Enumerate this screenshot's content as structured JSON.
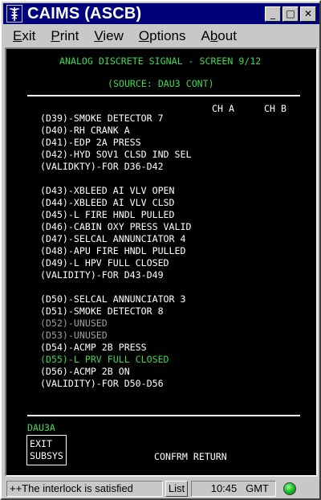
{
  "window": {
    "title": "CAIMS (ASCB)",
    "icon": "caduceus-icon",
    "controls": {
      "minimize": "_",
      "maximize": "□",
      "close": "✕"
    }
  },
  "menu": [
    {
      "mnemonic": "E",
      "rest": "xit"
    },
    {
      "mnemonic": "P",
      "rest": "rint"
    },
    {
      "mnemonic": "V",
      "rest": "iew"
    },
    {
      "mnemonic": "O",
      "rest": "ptions"
    },
    {
      "pre": "A",
      "mnemonic": "b",
      "rest": "out"
    }
  ],
  "screen": {
    "title": "ANALOG DISCRETE SIGNAL - SCREEN 9/12",
    "source": "(SOURCE: DAU3 CONT)",
    "columns": {
      "ch_a": "CH A",
      "ch_b": "CH B"
    },
    "groups": [
      [
        {
          "text": "(D39)-SMOKE DETECTOR 7",
          "color": "white"
        },
        {
          "text": "(D40)-RH CRANK A",
          "color": "white"
        },
        {
          "text": "(D41)-EDP 2A PRESS",
          "color": "white"
        },
        {
          "text": "(D42)-HYD SOV1 CLSD IND SEL",
          "color": "white"
        },
        {
          "text": "(VALIDKTY)-FOR D36-D42",
          "color": "white"
        }
      ],
      [
        {
          "text": "(D43)-XBLEED AI VLV OPEN",
          "color": "white"
        },
        {
          "text": "(D44)-XBLEED AI VLV CLSD",
          "color": "white"
        },
        {
          "text": "(D45)-L FIRE HNDL PULLED",
          "color": "white"
        },
        {
          "text": "(D46)-CABIN OXY PRESS VALID",
          "color": "white"
        },
        {
          "text": "(D47)-SELCAL ANNUNCIATOR 4",
          "color": "white"
        },
        {
          "text": "(D48)-APU FIRE HNDL PULLED",
          "color": "white"
        },
        {
          "text": "(D49)-L HPV FULL CLOSED",
          "color": "white"
        },
        {
          "text": "(VALIDITY)-FOR D43-D49",
          "color": "white"
        }
      ],
      [
        {
          "text": "(D50)-SELCAL ANNUNCIATOR 3",
          "color": "white"
        },
        {
          "text": "(D51)-SMOKE DETECTOR 8",
          "color": "white"
        },
        {
          "text": "(D52)-UNUSED",
          "color": "gray"
        },
        {
          "text": "(D53)-UNUSED",
          "color": "gray"
        },
        {
          "text": "(D54)-ACMP 2B PRESS",
          "color": "white"
        },
        {
          "text": "(D55)-L PRV FULL CLOSED",
          "color": "green"
        },
        {
          "text": "(D56)-ACMP 2B ON",
          "color": "white"
        },
        {
          "text": "(VALIDITY)-FOR D50-D56",
          "color": "white"
        }
      ]
    ],
    "unit_label": "DAU3A",
    "exit_button": {
      "line1": "EXIT",
      "line2": "SUBSYS"
    },
    "confirm_return": "CONFRM RETURN",
    "colors": {
      "white": "#ffffff",
      "gray": "#a0a0a0",
      "green": "#3fd94f"
    }
  },
  "status": {
    "message": "++The interlock is satisfied",
    "list_button": "List",
    "time": "10:45",
    "zone": "GMT",
    "indicator": "green-status-led"
  }
}
